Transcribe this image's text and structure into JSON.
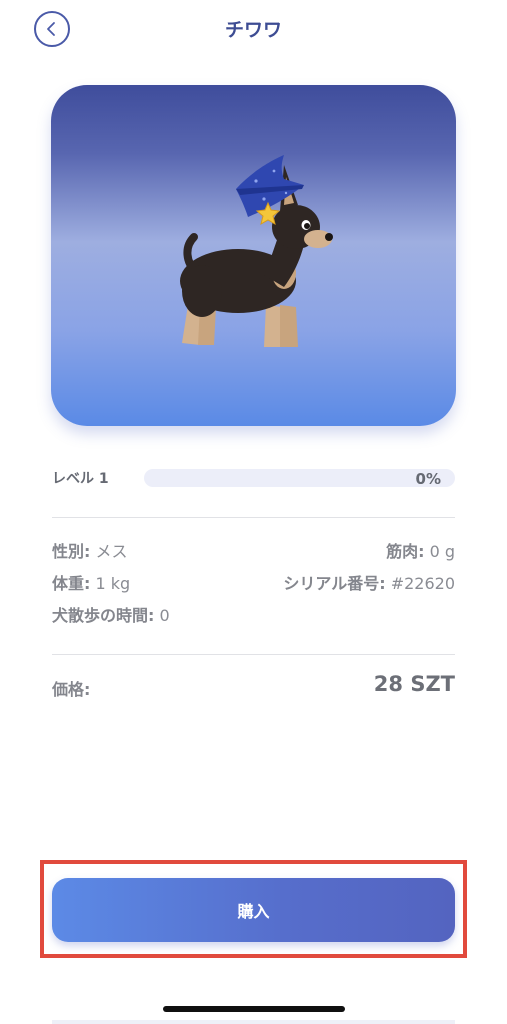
{
  "header": {
    "title": "チワワ",
    "back_icon": "chevron-left-icon"
  },
  "card": {
    "image": "chihuahua-wizard-hat",
    "gradient_colors": [
      "#3f4d9c",
      "#9eaee0",
      "#5a8ae6"
    ]
  },
  "level": {
    "label": "レベル 1",
    "percent_text": "0%",
    "progress": 0
  },
  "stats": {
    "gender_key": "性別:",
    "gender_value": " メス",
    "muscle_key": "筋肉:",
    "muscle_value": " 0 g",
    "weight_key": "体重:",
    "weight_value": " 1 kg",
    "serial_key": "シリアル番号:",
    "serial_value": " #22620",
    "walk_key": "犬散歩の時間:",
    "walk_value": " 0"
  },
  "price": {
    "label": "価格:",
    "value": "28 SZT"
  },
  "actions": {
    "buy_label": "購入"
  },
  "colors": {
    "accent": "#4a5aa8",
    "button_start": "#5c8ae6",
    "button_end": "#5464c0",
    "highlight_border": "#e14a3d"
  }
}
